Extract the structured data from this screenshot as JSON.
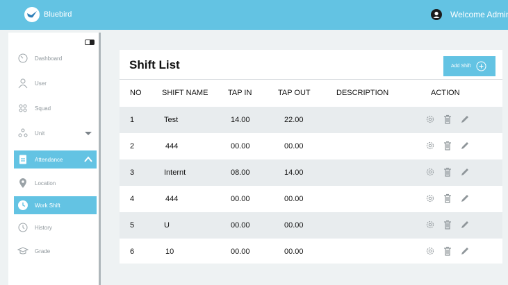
{
  "app": {
    "brand_name": "Bluebird",
    "welcome_text": "Welcome Admin"
  },
  "sidebar": {
    "items": [
      {
        "label": "Dashboard",
        "icon": "dashboard-icon"
      },
      {
        "label": "User",
        "icon": "user-icon"
      },
      {
        "label": "Squad",
        "icon": "squad-icon"
      },
      {
        "label": "Unit",
        "icon": "unit-icon"
      },
      {
        "label": "Attendance",
        "icon": "attendance-icon"
      },
      {
        "label": "Location",
        "icon": "location-icon"
      },
      {
        "label": "Work Shift",
        "icon": "clock-icon"
      },
      {
        "label": "History",
        "icon": "history-icon"
      },
      {
        "label": "Grade",
        "icon": "grade-icon"
      }
    ]
  },
  "main": {
    "title": "Shift List",
    "add_button_label": "Add Shift",
    "columns": [
      "NO",
      "SHIFT NAME",
      "TAP IN",
      "TAP OUT",
      "DESCRIPTION",
      "ACTION"
    ],
    "rows": [
      {
        "no": "1",
        "name": "Test",
        "tap_in": "14.00",
        "tap_out": "22.00",
        "description": ""
      },
      {
        "no": "2",
        "name": "444",
        "tap_in": "00.00",
        "tap_out": "00.00",
        "description": ""
      },
      {
        "no": "3",
        "name": "Internt",
        "tap_in": "08.00",
        "tap_out": "14.00",
        "description": ""
      },
      {
        "no": "4",
        "name": "444",
        "tap_in": "00.00",
        "tap_out": "00.00",
        "description": ""
      },
      {
        "no": "5",
        "name": "U",
        "tap_in": "00.00",
        "tap_out": "00.00",
        "description": ""
      },
      {
        "no": "6",
        "name": "10",
        "tap_in": "00.00",
        "tap_out": "00.00",
        "description": ""
      }
    ]
  },
  "colors": {
    "accent": "#63c3e3",
    "row_shade": "#e8ecee",
    "page_bg": "#eef2f3"
  }
}
